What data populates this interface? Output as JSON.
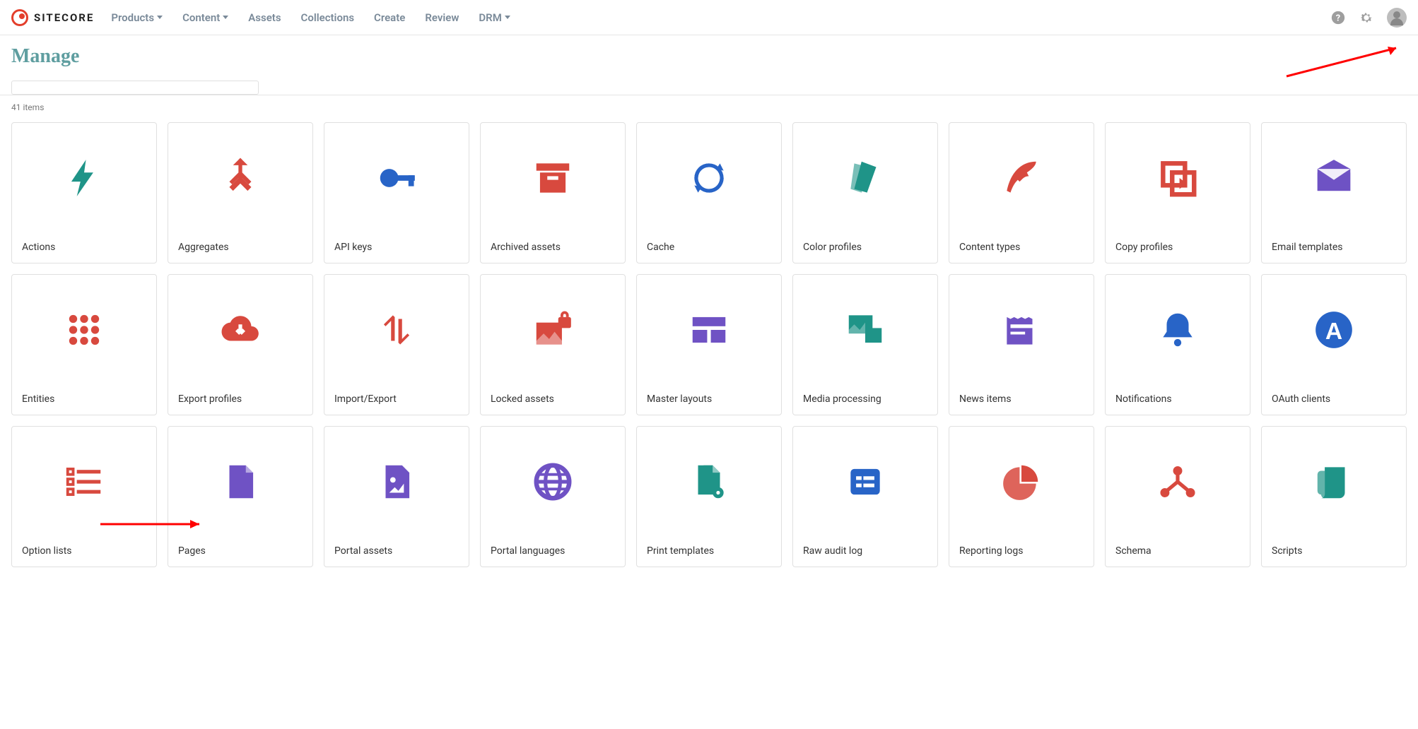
{
  "logo": "SITECORE",
  "nav": [
    {
      "label": "Products",
      "dropdown": true
    },
    {
      "label": "Content",
      "dropdown": true
    },
    {
      "label": "Assets",
      "dropdown": false
    },
    {
      "label": "Collections",
      "dropdown": false
    },
    {
      "label": "Create",
      "dropdown": false
    },
    {
      "label": "Review",
      "dropdown": false
    },
    {
      "label": "DRM",
      "dropdown": true
    }
  ],
  "page_title": "Manage",
  "count_text": "41 items",
  "tiles": [
    {
      "label": "Actions",
      "icon": "bolt",
      "color": "teal"
    },
    {
      "label": "Aggregates",
      "icon": "merge",
      "color": "red"
    },
    {
      "label": "API keys",
      "icon": "key",
      "color": "blue"
    },
    {
      "label": "Archived assets",
      "icon": "archive",
      "color": "red"
    },
    {
      "label": "Cache",
      "icon": "refresh",
      "color": "blue"
    },
    {
      "label": "Color profiles",
      "icon": "swatches",
      "color": "teal"
    },
    {
      "label": "Content types",
      "icon": "feather",
      "color": "red"
    },
    {
      "label": "Copy profiles",
      "icon": "copy",
      "color": "red"
    },
    {
      "label": "Email templates",
      "icon": "envelope",
      "color": "purple"
    },
    {
      "label": "Entities",
      "icon": "grid9",
      "color": "red"
    },
    {
      "label": "Export profiles",
      "icon": "clouddown",
      "color": "red"
    },
    {
      "label": "Import/Export",
      "icon": "updown",
      "color": "red"
    },
    {
      "label": "Locked assets",
      "icon": "lockimage",
      "color": "red"
    },
    {
      "label": "Master layouts",
      "icon": "layout",
      "color": "purple"
    },
    {
      "label": "Media processing",
      "icon": "media",
      "color": "teal"
    },
    {
      "label": "News items",
      "icon": "news",
      "color": "purple"
    },
    {
      "label": "Notifications",
      "icon": "bell",
      "color": "blue"
    },
    {
      "label": "OAuth clients",
      "icon": "oauth",
      "color": "blue"
    },
    {
      "label": "Option lists",
      "icon": "list",
      "color": "red"
    },
    {
      "label": "Pages",
      "icon": "page",
      "color": "purple"
    },
    {
      "label": "Portal assets",
      "icon": "pageimg",
      "color": "purple"
    },
    {
      "label": "Portal languages",
      "icon": "globe",
      "color": "purple"
    },
    {
      "label": "Print templates",
      "icon": "pagegear",
      "color": "teal"
    },
    {
      "label": "Raw audit log",
      "icon": "form",
      "color": "blue"
    },
    {
      "label": "Reporting logs",
      "icon": "pie",
      "color": "red"
    },
    {
      "label": "Schema",
      "icon": "schema",
      "color": "red"
    },
    {
      "label": "Scripts",
      "icon": "scroll",
      "color": "teal"
    }
  ]
}
